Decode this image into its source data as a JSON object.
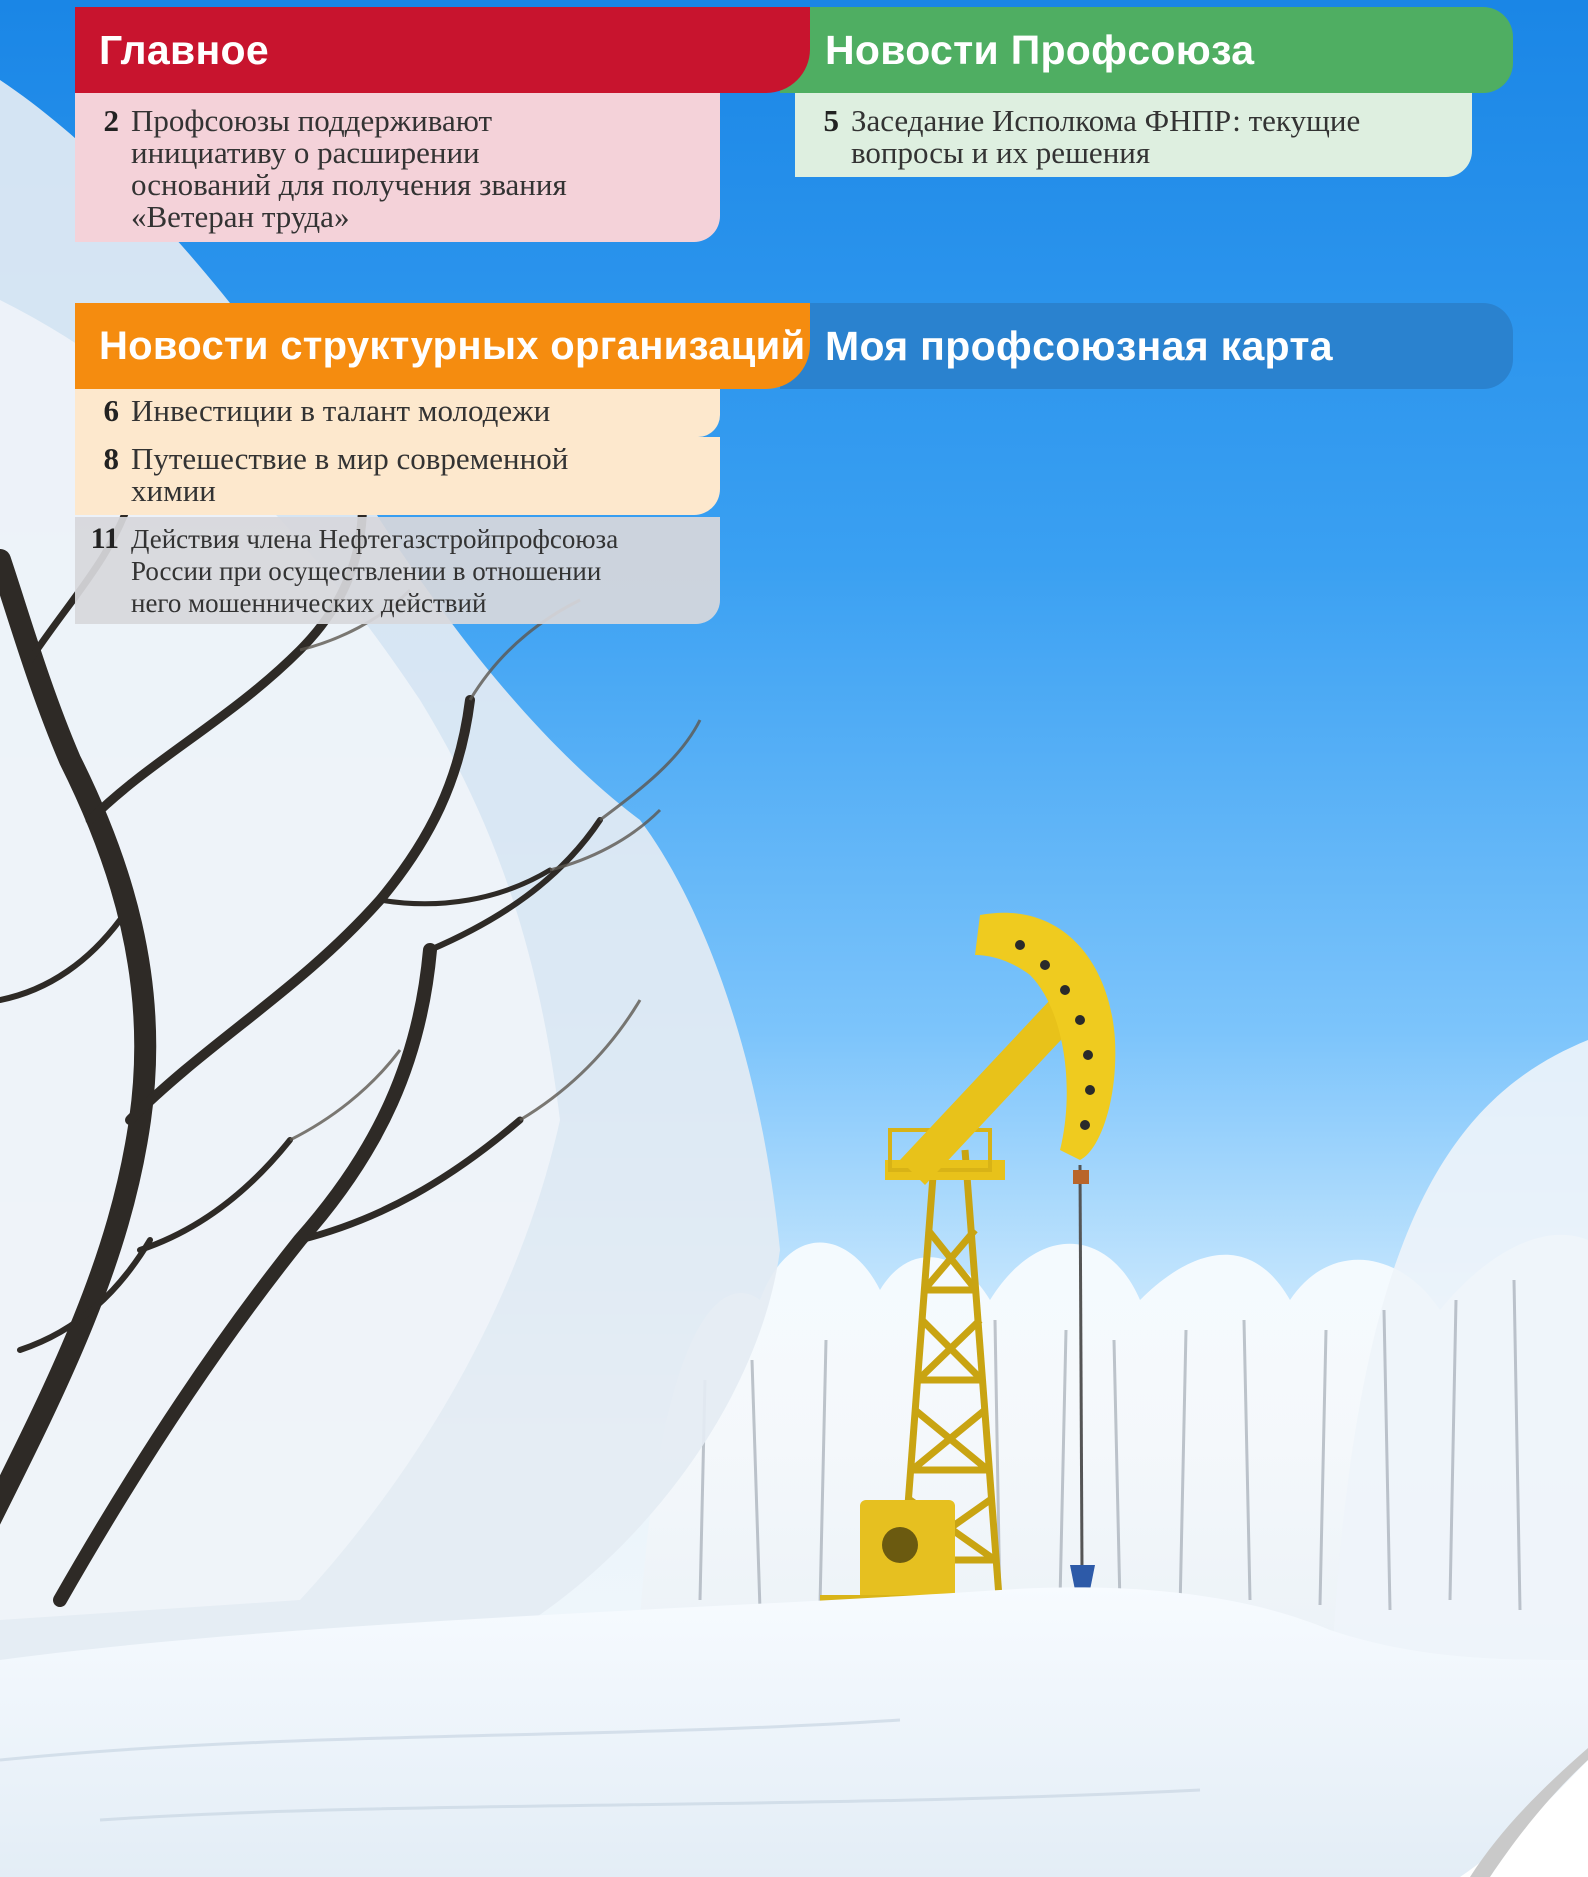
{
  "sections": {
    "main": {
      "title": "Главное",
      "items": [
        {
          "page": "2",
          "text_lines": [
            "Профсоюзы поддерживают",
            "инициативу о расширении",
            "оснований для получения звания",
            "«Ветеран труда»"
          ]
        }
      ]
    },
    "union_news": {
      "title": "Новости Профсоюза",
      "items": [
        {
          "page": "5",
          "text_lines": [
            "Заседание Исполкома ФНПР: текущие",
            "вопросы и их решения"
          ]
        }
      ]
    },
    "structural_news": {
      "title": "Новости структурных организаций",
      "items": [
        {
          "page": "6",
          "text_lines": [
            "Инвестиции в талант молодежи"
          ]
        },
        {
          "page": "8",
          "text_lines": [
            "Путешествие в мир современной",
            "химии"
          ]
        },
        {
          "page": "11",
          "text_lines": [
            "Действия члена Нефтегазстройпрофсоюза",
            "России при осуществлении в отношении",
            "него мошеннических действий"
          ]
        }
      ]
    },
    "my_card": {
      "title": "Моя профсоюзная карта"
    }
  },
  "colors": {
    "main": "#c8142e",
    "union_news": "#4fae62",
    "structural_news": "#f58c0f",
    "my_card": "#2a82cf",
    "pump_jack": "#e8c21a"
  }
}
